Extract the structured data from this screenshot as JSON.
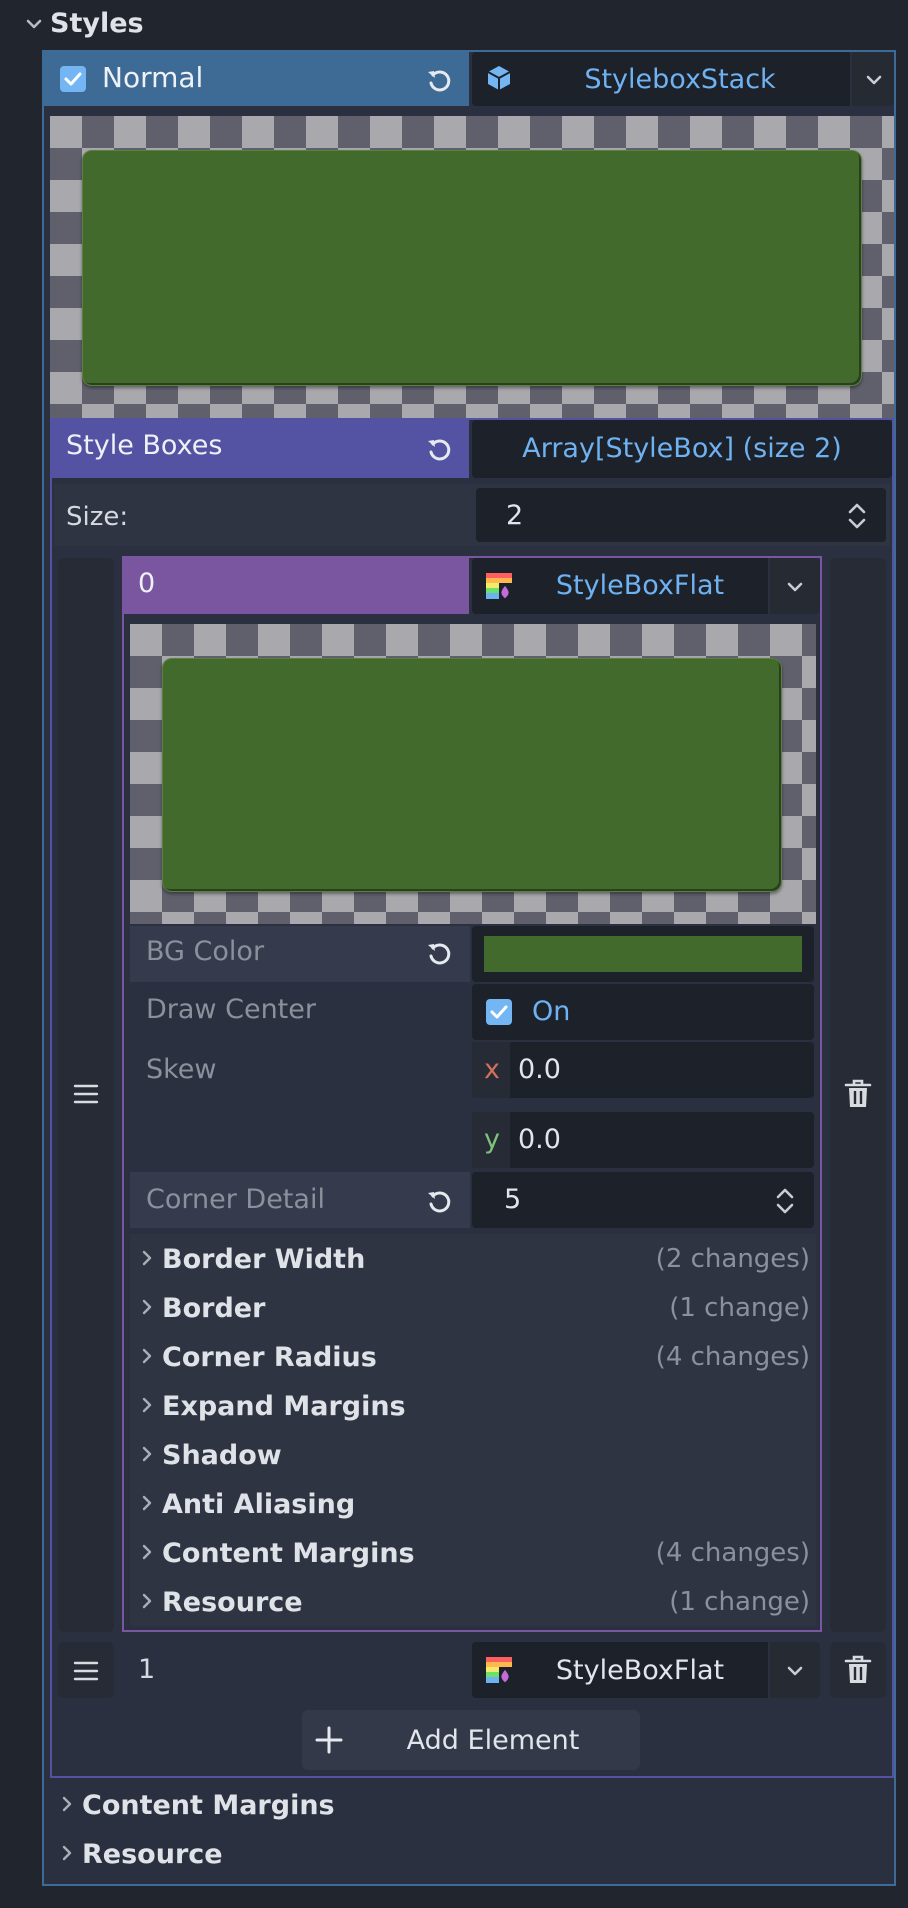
{
  "section": {
    "title": "Styles"
  },
  "normal": {
    "label": "Normal",
    "checked": true,
    "resource_type": "StyleboxStack",
    "preview_color": "#436a2d"
  },
  "style_boxes": {
    "label": "Style Boxes",
    "value": "Array[StyleBox] (size 2)",
    "size_label": "Size:",
    "size_value": "2"
  },
  "element0": {
    "index": "0",
    "type": "StyleBoxFlat",
    "preview_color": "#436a2d",
    "bg_color_label": "BG Color",
    "bg_color": "#436a2d",
    "draw_center_label": "Draw Center",
    "draw_center_value": "On",
    "skew_label": "Skew",
    "skew_x_axis": "x",
    "skew_x": "0.0",
    "skew_y_axis": "y",
    "skew_y": "0.0",
    "corner_detail_label": "Corner Detail",
    "corner_detail_value": "5",
    "groups": [
      {
        "label": "Border Width",
        "changes": "(2 changes)"
      },
      {
        "label": "Border",
        "changes": "(1 change)"
      },
      {
        "label": "Corner Radius",
        "changes": "(4 changes)"
      },
      {
        "label": "Expand Margins",
        "changes": ""
      },
      {
        "label": "Shadow",
        "changes": ""
      },
      {
        "label": "Anti Aliasing",
        "changes": ""
      },
      {
        "label": "Content Margins",
        "changes": "(4 changes)"
      },
      {
        "label": "Resource",
        "changes": "(1 change)"
      }
    ]
  },
  "element1": {
    "index": "1",
    "type": "StyleBoxFlat"
  },
  "add_element": {
    "label": "Add Element"
  },
  "outer_groups": [
    {
      "label": "Content Margins"
    },
    {
      "label": "Resource"
    }
  ],
  "colors": {
    "accent_blue": "#6fb2f2",
    "normal_header": "#3e6a96",
    "style_boxes_header": "#5452a3",
    "element_header": "#7a55a0",
    "panel_bg": "#21252e"
  }
}
